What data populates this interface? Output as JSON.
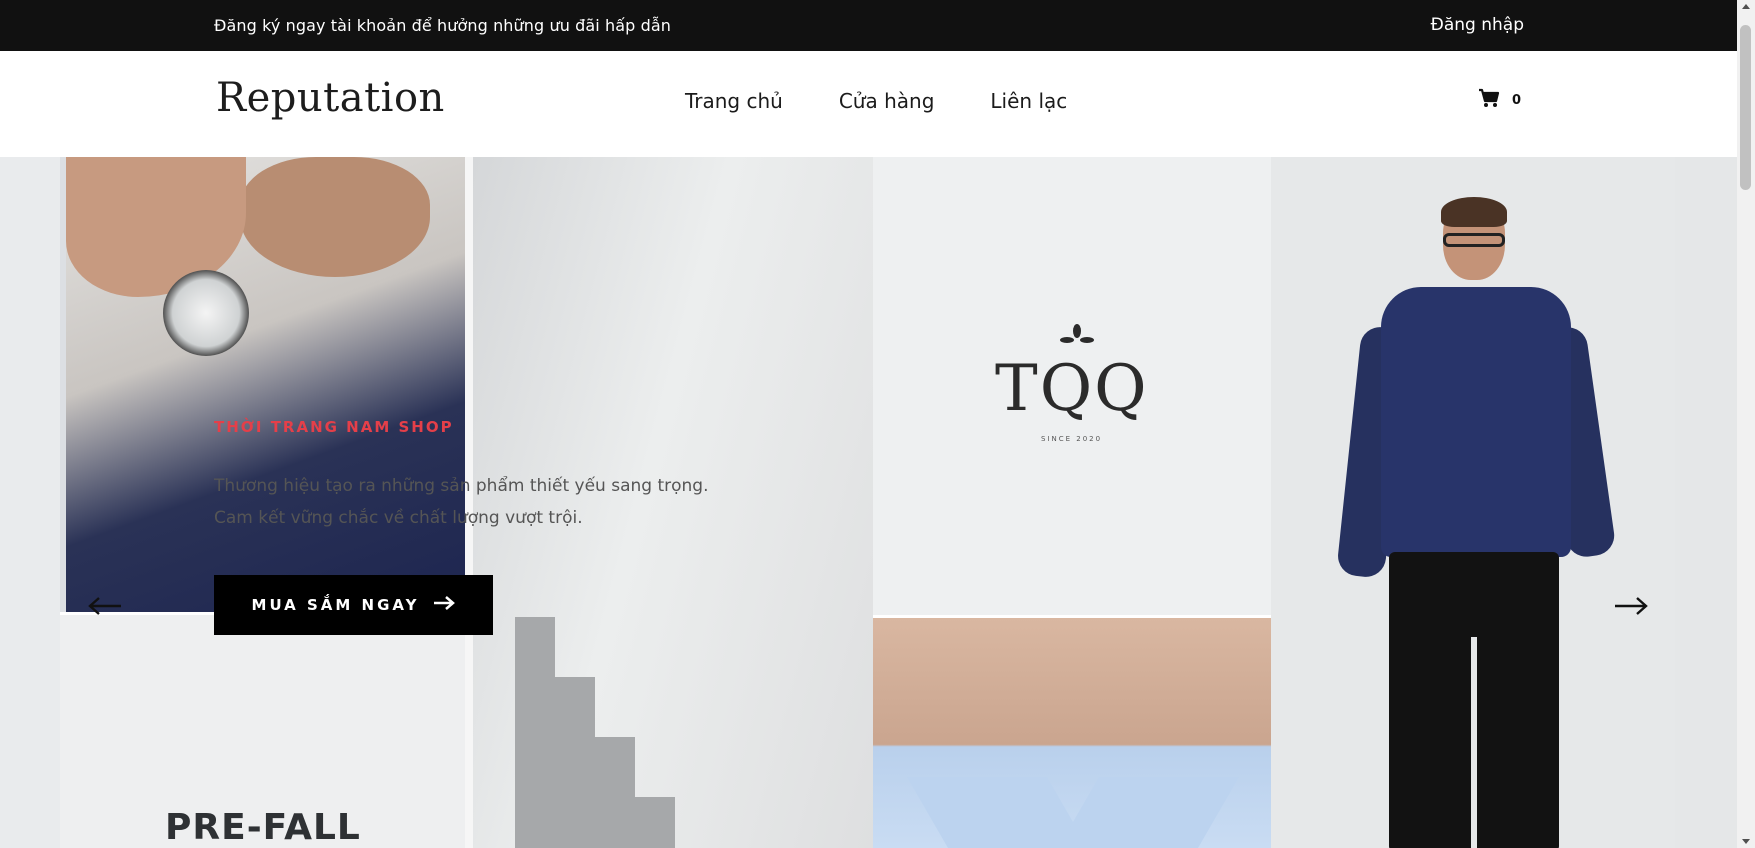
{
  "topbar": {
    "promo_text": "Đăng ký ngay tài khoản để hưởng những ưu đãi hấp dẫn",
    "login_label": "Đăng nhập"
  },
  "header": {
    "logo": "Reputation",
    "nav": [
      {
        "label": "Trang chủ"
      },
      {
        "label": "Cửa hàng"
      },
      {
        "label": "Liên lạc"
      }
    ],
    "cart_count": "0"
  },
  "hero": {
    "eyebrow": "THỜI TRANG NAM SHOP",
    "description": "Thương hiệu tạo ra những sản phẩm thiết yếu sang trọng. Cam kết vững chắc về chất lượng vượt trội.",
    "cta_label": "MUA SẮM NGAY",
    "panel_texts": {
      "prefall": "PRE-FALL",
      "brand": "TQQ",
      "brand_sub": "SINCE 2020"
    }
  },
  "colors": {
    "topbar_bg": "#111111",
    "accent": "#e53f49",
    "cta_bg": "#000000"
  },
  "icons": {
    "cart": "cart-icon",
    "prev": "arrow-left-icon",
    "next": "arrow-right-icon",
    "cta": "arrow-right-icon"
  }
}
